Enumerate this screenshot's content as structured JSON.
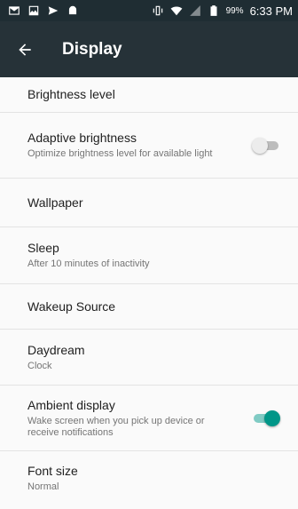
{
  "status_bar": {
    "battery_percent": "99%",
    "time": "6:33 PM",
    "left_icons": [
      "mail-icon",
      "image-icon",
      "send-icon",
      "android-icon"
    ],
    "right_icons": [
      "vibrate-icon",
      "wifi-icon",
      "no-signal-icon",
      "battery-icon"
    ]
  },
  "toolbar": {
    "title": "Display",
    "back_icon": "arrow-back-icon",
    "background": "#263238"
  },
  "settings": {
    "brightness": {
      "title": "Brightness level"
    },
    "adaptive_brightness": {
      "title": "Adaptive brightness",
      "summary": "Optimize brightness level for available light",
      "enabled": false
    },
    "wallpaper": {
      "title": "Wallpaper"
    },
    "sleep": {
      "title": "Sleep",
      "summary": "After 10 minutes of inactivity"
    },
    "wakeup_source": {
      "title": "Wakeup Source"
    },
    "daydream": {
      "title": "Daydream",
      "summary": "Clock"
    },
    "ambient_display": {
      "title": "Ambient display",
      "summary": "Wake screen when you pick up device or receive notifications",
      "enabled": true
    },
    "font_size": {
      "title": "Font size",
      "summary": "Normal"
    }
  },
  "colors": {
    "accent": "#009688",
    "status_bar": "#1f2d33"
  }
}
